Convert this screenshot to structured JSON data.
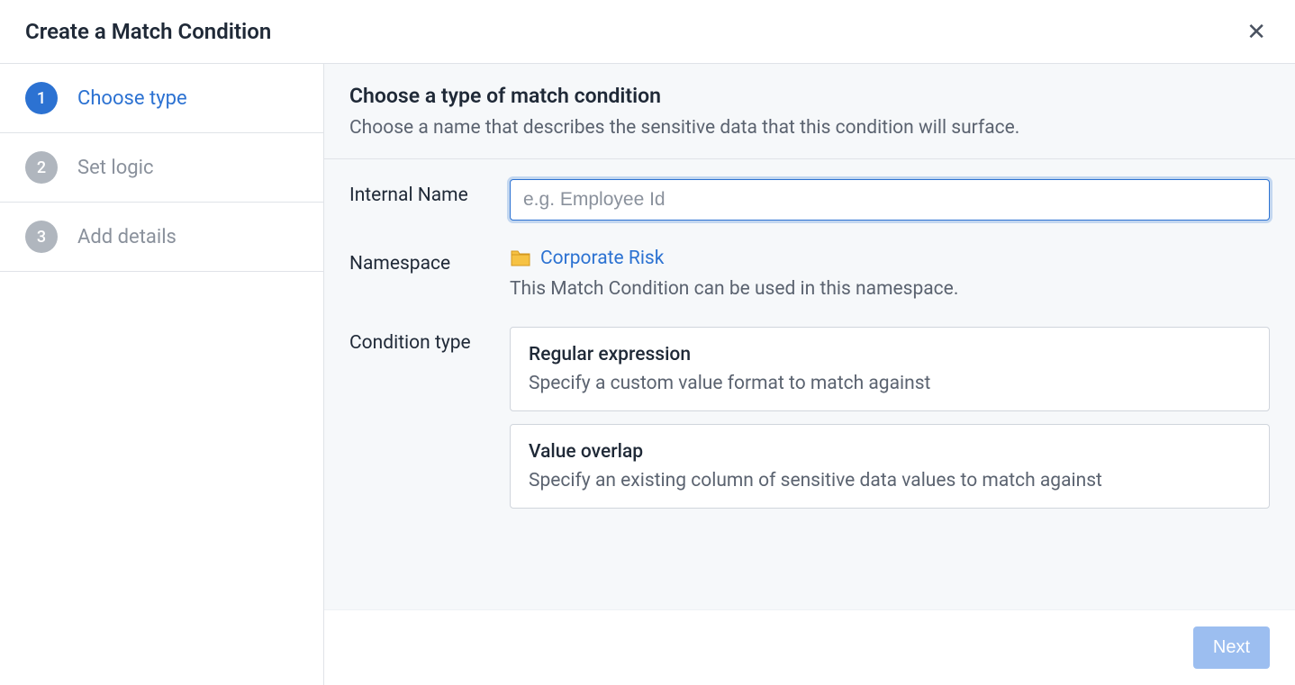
{
  "dialog": {
    "title": "Create a Match Condition"
  },
  "steps": [
    {
      "num": "1",
      "label": "Choose type",
      "active": true
    },
    {
      "num": "2",
      "label": "Set logic",
      "active": false
    },
    {
      "num": "3",
      "label": "Add details",
      "active": false
    }
  ],
  "main": {
    "heading": "Choose a type of match condition",
    "subheading": "Choose a name that describes the sensitive data that this condition will surface.",
    "internalName": {
      "label": "Internal Name",
      "placeholder": "e.g. Employee Id",
      "value": ""
    },
    "namespace": {
      "label": "Namespace",
      "link": "Corporate Risk",
      "help": "This Match Condition can be used in this namespace."
    },
    "conditionType": {
      "label": "Condition type",
      "options": [
        {
          "title": "Regular expression",
          "desc": "Specify a custom value format to match against"
        },
        {
          "title": "Value overlap",
          "desc": "Specify an existing column of sensitive data values to match against"
        }
      ]
    }
  },
  "footer": {
    "nextLabel": "Next"
  }
}
